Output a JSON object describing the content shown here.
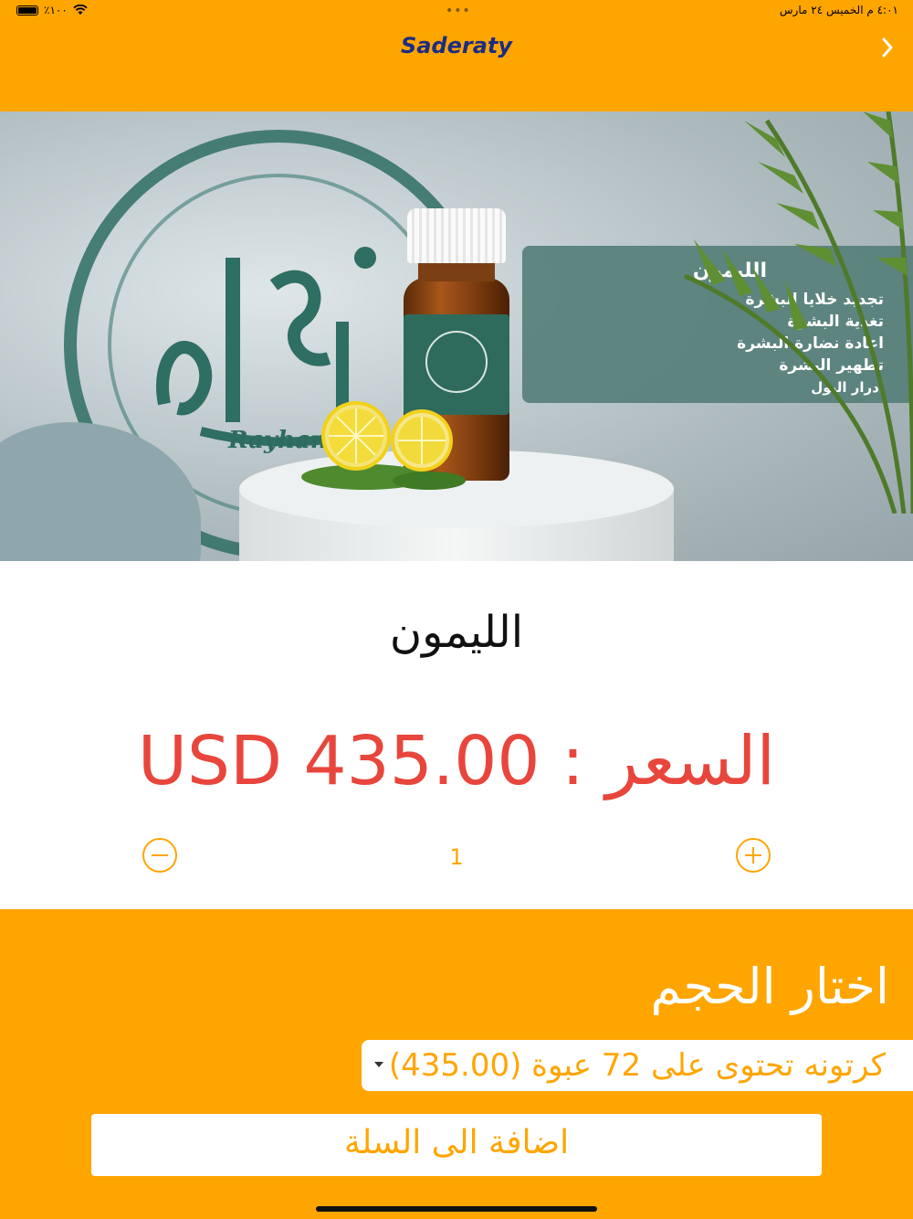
{
  "status_bar": {
    "battery": "٪١٠٠",
    "time_date": "٤:٠١ م   الخميس ٢٤ مارس",
    "dots": "•••"
  },
  "header": {
    "logo": "Saderaty"
  },
  "banner": {
    "brand": "Rayhan",
    "panel_title": "الليمون",
    "panel_lines": [
      "تجديد خلايا البشرة",
      "تغدية البشرة",
      "اعادة نضارة البشرة",
      "تطهير البشرة",
      "ادرار البول"
    ]
  },
  "product": {
    "name": "الليمون",
    "price": "السعر : USD 435.00"
  },
  "quantity": {
    "value": "1"
  },
  "options": {
    "size_title": "اختار الحجم",
    "selected": "كرتونه تحتوى على 72 عبوة     (435.00)",
    "add_to_cart": "اضافة الى السلة"
  },
  "colors": {
    "accent": "#FFA500",
    "price": "#e8463c",
    "brand_green": "#2f6e62"
  }
}
